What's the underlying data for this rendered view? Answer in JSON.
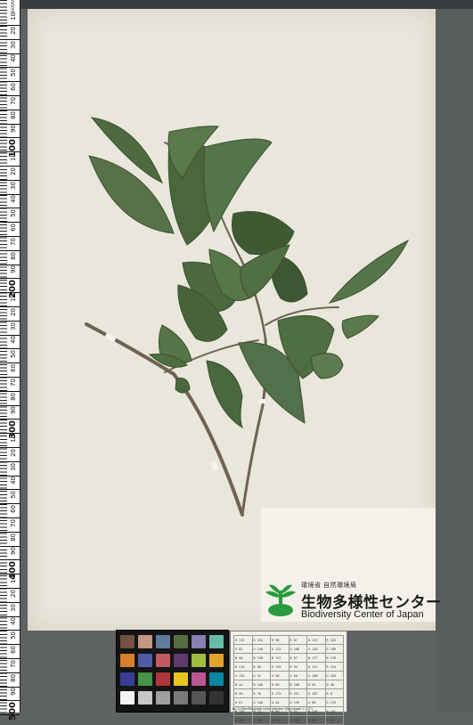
{
  "ruler": {
    "labels": [
      "10",
      "20",
      "30",
      "40",
      "50",
      "60",
      "70",
      "80",
      "90",
      "100",
      "10",
      "20",
      "30",
      "40",
      "50",
      "60",
      "70",
      "80",
      "90",
      "200",
      "10",
      "20",
      "30",
      "40",
      "50",
      "60",
      "70",
      "80",
      "90",
      "300",
      "10",
      "20",
      "30",
      "40",
      "50",
      "60",
      "70",
      "80",
      "90",
      "400",
      "10",
      "20",
      "30",
      "40",
      "50",
      "60",
      "70",
      "80",
      "90",
      "500"
    ],
    "corner_text": "BIODIV"
  },
  "logo": {
    "subtitle": "環境省 自然環境局",
    "title": "生物多様性センター",
    "english": "Biodiversity Center of Japan",
    "brand_color": "#2a9a3c"
  },
  "color_checker": {
    "caption": "by X-Rite/Macbeth color checker (Illuminant C / 2°)",
    "patches": [
      "#735244",
      "#c29682",
      "#627a9d",
      "#576c43",
      "#8580b1",
      "#67bdaa",
      "#d67e2c",
      "#505ba6",
      "#c15a63",
      "#5e3c6c",
      "#9dbc40",
      "#e0a32e",
      "#383d96",
      "#469449",
      "#af363c",
      "#e7c71f",
      "#bb5695",
      "#0885a1",
      "#f3f3f2",
      "#c8c8c8",
      "#a0a0a0",
      "#7a7a79",
      "#555555",
      "#343434"
    ]
  },
  "reference_table": {
    "rows": [
      [
        "R 115",
        "R 194",
        "R 98",
        "R 87",
        "R 133",
        "R 103"
      ],
      [
        "G 82",
        "G 150",
        "G 122",
        "G 108",
        "G 128",
        "G 189"
      ],
      [
        "B 68",
        "B 130",
        "B 157",
        "B 67",
        "B 177",
        "B 170"
      ],
      [
        "R 214",
        "R 80",
        "R 193",
        "R 94",
        "R 157",
        "R 224"
      ],
      [
        "G 126",
        "G 91",
        "G 90",
        "G 60",
        "G 188",
        "G 163"
      ],
      [
        "B 44",
        "B 166",
        "B 99",
        "B 108",
        "B 64",
        "B 46"
      ],
      [
        "R 56",
        "R 70",
        "R 175",
        "R 231",
        "R 187",
        "R 8"
      ],
      [
        "G 61",
        "G 148",
        "G 54",
        "G 199",
        "G 86",
        "G 133"
      ],
      [
        "B 150",
        "B 73",
        "B 60",
        "B 31",
        "B 149",
        "B 161"
      ],
      [
        "R 243",
        "R 200",
        "R 160",
        "R 122",
        "R 85",
        "R 52"
      ]
    ]
  }
}
